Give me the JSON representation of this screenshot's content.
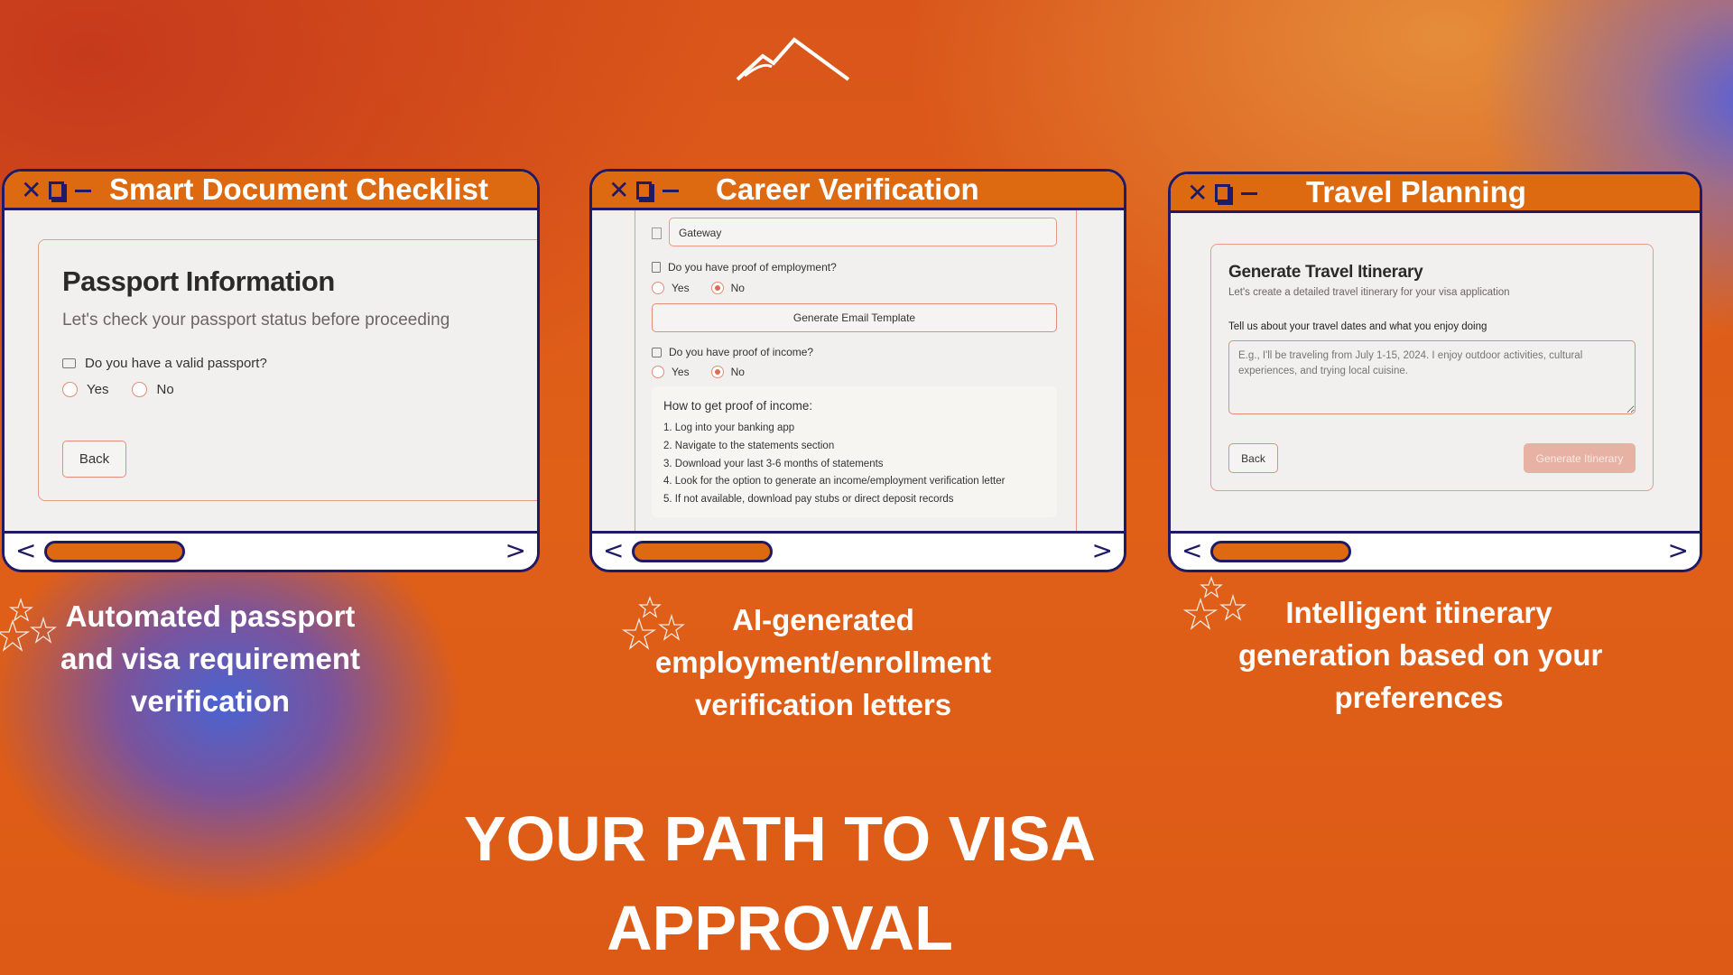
{
  "logo": {
    "icon": "mountain-icon"
  },
  "windows": [
    {
      "title": "Smart Document Checklist",
      "card": {
        "title": "Passport Information",
        "subtitle": "Let's check your passport status before proceeding",
        "question": "Do you have a valid passport?",
        "options": [
          "Yes",
          "No"
        ],
        "selected": null,
        "back": "Back"
      }
    },
    {
      "title": "Career Verification",
      "company_value": "Gateway",
      "q1": "Do you have proof of employment?",
      "q1_options": [
        "Yes",
        "No"
      ],
      "q1_selected": "No",
      "email_button": "Generate Email Template",
      "q2": "Do you have proof of income?",
      "q2_options": [
        "Yes",
        "No"
      ],
      "q2_selected": "No",
      "info": {
        "heading": "How to get proof of income:",
        "steps": [
          "1. Log into your banking app",
          "2. Navigate to the statements section",
          "3. Download your last 3-6 months of statements",
          "4. Look for the option to generate an income/employment verification letter",
          "5. If not available, download pay stubs or direct deposit records"
        ]
      }
    },
    {
      "title": "Travel Planning",
      "card": {
        "title": "Generate Travel Itinerary",
        "subtitle": "Let's create a detailed travel itinerary for your visa application",
        "label": "Tell us about your travel dates and what you enjoy doing",
        "placeholder": "E.g., I'll be traveling from July 1-15, 2024. I enjoy outdoor activities, cultural experiences, and trying local cuisine.",
        "back": "Back",
        "generate": "Generate Itinerary"
      }
    }
  ],
  "nav": {
    "prev": "<",
    "next": ">"
  },
  "captions": [
    [
      "Automated passport",
      "and visa requirement",
      "verification"
    ],
    [
      "AI-generated",
      "employment/enrollment",
      "verification letters"
    ],
    [
      "Intelligent itinerary",
      "generation based on your",
      "preferences"
    ]
  ],
  "headline": [
    "YOUR PATH TO VISA",
    "APPROVAL"
  ],
  "colors": {
    "accent": "#dd6a10",
    "border": "#1e1a66",
    "form_border": "#e38c78"
  }
}
